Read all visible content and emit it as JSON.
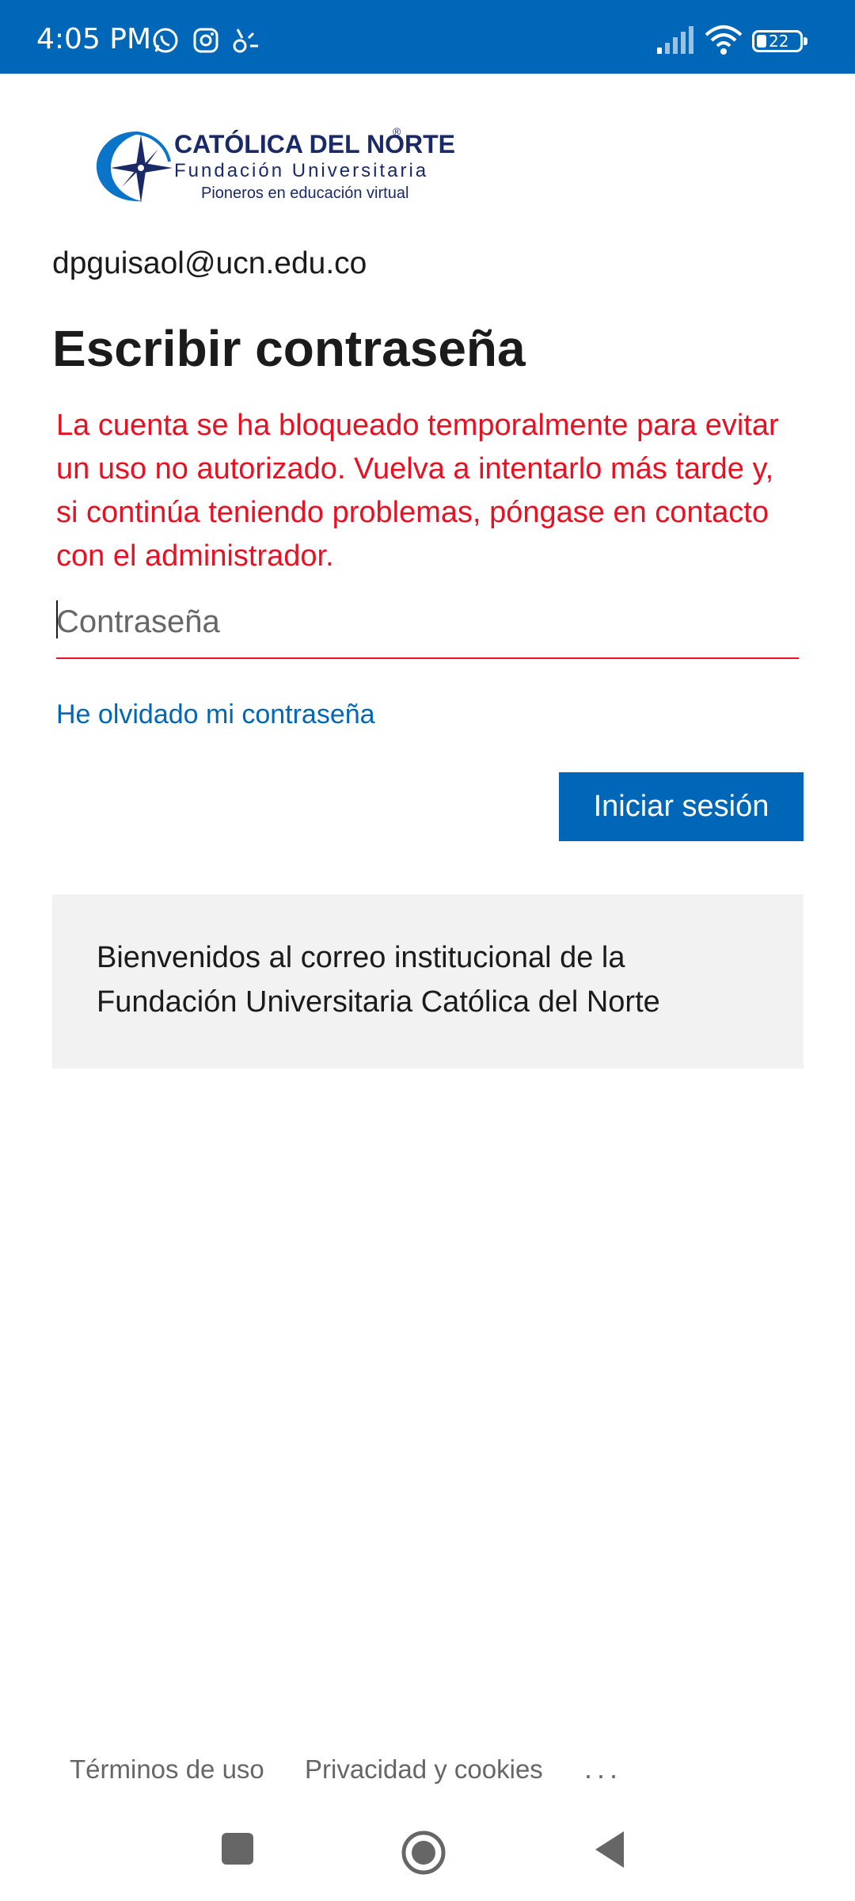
{
  "status_bar": {
    "time": "4:05 PM",
    "battery": "22",
    "left_icons": [
      "whatsapp-icon",
      "instagram-icon",
      "app-notification-icon"
    ],
    "right_icons": [
      "signal-icon",
      "wifi-icon",
      "battery-icon"
    ]
  },
  "logo": {
    "brand": "CATÓLICA DEL NORTE",
    "subtitle": "Fundación Universitaria",
    "tagline": "Pioneros en educación virtual",
    "registered": "®"
  },
  "account": {
    "email": "dpguisaol@ucn.edu.co"
  },
  "page": {
    "title": "Escribir contraseña"
  },
  "error": {
    "message": "La cuenta se ha bloqueado temporalmente para evitar un uso no autorizado. Vuelva a intentarlo más tarde y, si continúa teniendo problemas, póngase en contacto con el administrador."
  },
  "password": {
    "placeholder": "Contraseña",
    "value": ""
  },
  "links": {
    "forgot_password": "He olvidado mi contraseña"
  },
  "buttons": {
    "sign_in": "Iniciar sesión"
  },
  "welcome": {
    "text": "Bienvenidos al correo institucional de la Fundación Universitaria Católica del Norte"
  },
  "footer": {
    "terms": "Términos de uso",
    "privacy": "Privacidad y cookies",
    "more": "..."
  },
  "colors": {
    "accent": "#0067b8",
    "error": "#e81123",
    "panel": "#f2f2f2"
  }
}
